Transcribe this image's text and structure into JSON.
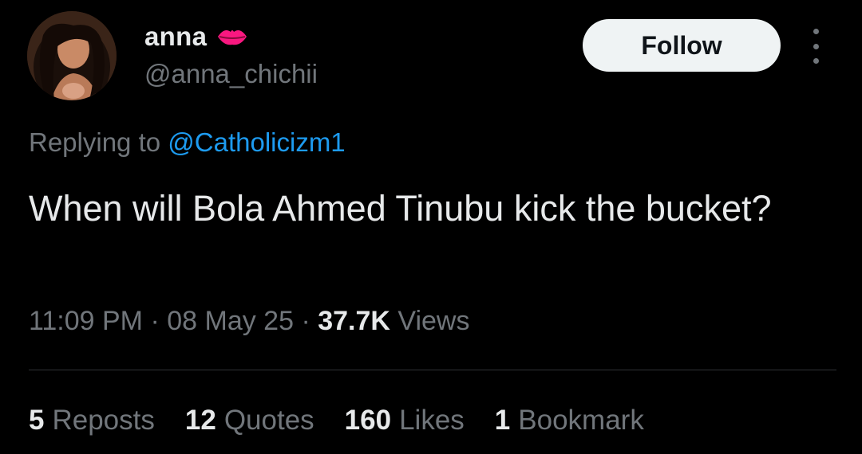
{
  "author": {
    "display_name": "anna",
    "handle": "@anna_chichii",
    "emoji_icon": "kiss-lips-icon",
    "avatar_icon": "profile-photo"
  },
  "follow_button": {
    "label": "Follow"
  },
  "more_menu": {
    "icon": "more-vertical-icon"
  },
  "reply": {
    "prefix": "Replying to ",
    "mention": "@Catholicizm1"
  },
  "tweet": {
    "text": "When will Bola Ahmed Tinubu kick the bucket?"
  },
  "meta": {
    "time": "11:09 PM",
    "separator": " · ",
    "date": "08 May 25",
    "views_count": "37.7K",
    "views_label": " Views"
  },
  "stats": [
    {
      "count": "5",
      "label": "Reposts"
    },
    {
      "count": "12",
      "label": "Quotes"
    },
    {
      "count": "160",
      "label": "Likes"
    },
    {
      "count": "1",
      "label": "Bookmark"
    }
  ],
  "colors": {
    "background": "#000000",
    "text_primary": "#e7e9ea",
    "text_secondary": "#71767b",
    "link": "#1d9bf0",
    "follow_button_bg": "#eff3f4",
    "divider": "#2f3336",
    "lips": "#f91880"
  }
}
